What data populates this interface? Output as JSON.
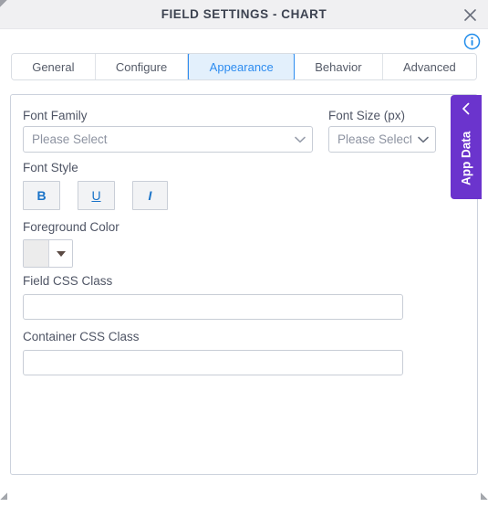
{
  "window": {
    "title": "FIELD SETTINGS - CHART",
    "close_icon": "close-icon",
    "info_icon": "info-icon"
  },
  "tabs": [
    {
      "label": "General",
      "active": false
    },
    {
      "label": "Configure",
      "active": false
    },
    {
      "label": "Appearance",
      "active": true
    },
    {
      "label": "Behavior",
      "active": false
    },
    {
      "label": "Advanced",
      "active": false
    }
  ],
  "form": {
    "font_family": {
      "label": "Font Family",
      "value": "Please Select",
      "caret_icon": "chevron-down-icon"
    },
    "font_size": {
      "label": "Font Size (px)",
      "value": "Please Select",
      "caret_icon": "chevron-down-icon"
    },
    "font_style": {
      "label": "Font Style",
      "buttons": [
        {
          "label": "B",
          "name": "bold-button"
        },
        {
          "label": "U",
          "name": "underline-button"
        },
        {
          "label": "I",
          "name": "italic-button"
        }
      ]
    },
    "foreground_color": {
      "label": "Foreground Color",
      "swatch_color": "#ececec",
      "caret_icon": "triangle-down-icon"
    },
    "field_css_class": {
      "label": "Field CSS Class",
      "value": "",
      "placeholder": ""
    },
    "container_css_class": {
      "label": "Container CSS Class",
      "value": "",
      "placeholder": ""
    }
  },
  "side_panel": {
    "label": "App Data",
    "chevron_icon": "chevron-left-icon",
    "color": "#6b34cd"
  },
  "colors": {
    "accent_blue": "#2d8cf0",
    "titlebar_bg": "#f0f0f2",
    "text": "#4f5565",
    "border": "#ccd2dd"
  }
}
